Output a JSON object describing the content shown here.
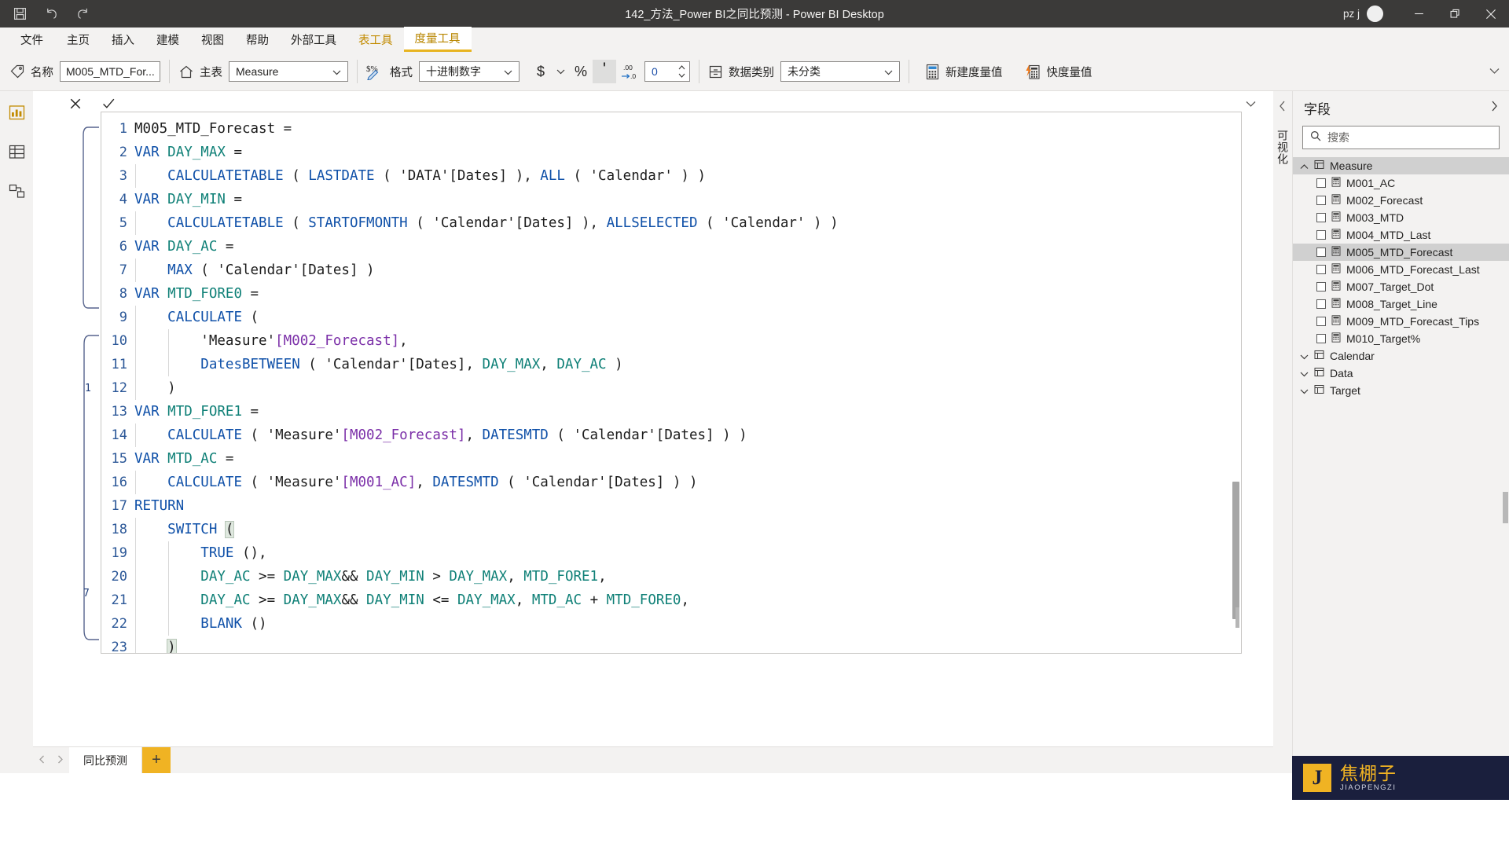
{
  "window": {
    "title": "142_方法_Power BI之同比预测 - Power BI Desktop",
    "user": "pz j",
    "quick_access": [
      {
        "name": "save-icon",
        "label": "保存"
      },
      {
        "name": "undo-icon",
        "label": "撤消"
      },
      {
        "name": "redo-icon",
        "label": "恢复"
      }
    ],
    "controls": [
      {
        "name": "minimize-button",
        "label": "最小化"
      },
      {
        "name": "restore-button",
        "label": "还原"
      },
      {
        "name": "close-button",
        "label": "关闭"
      }
    ]
  },
  "ribbon": {
    "tabs": [
      {
        "label": "文件",
        "type": "file",
        "active": false
      },
      {
        "label": "主页",
        "type": "normal",
        "active": false
      },
      {
        "label": "插入",
        "type": "normal",
        "active": false
      },
      {
        "label": "建模",
        "type": "normal",
        "active": false
      },
      {
        "label": "视图",
        "type": "normal",
        "active": false
      },
      {
        "label": "帮助",
        "type": "normal",
        "active": false
      },
      {
        "label": "外部工具",
        "type": "normal",
        "active": false
      },
      {
        "label": "表工具",
        "type": "context",
        "active": false
      },
      {
        "label": "度量工具",
        "type": "context",
        "active": true
      }
    ],
    "structure_group": {
      "name_label": "名称",
      "name_value": "M005_MTD_For...",
      "home_table_label": "主表",
      "home_table_value": "Measure"
    },
    "format_group": {
      "format_label": "格式",
      "format_value": "十进制数字",
      "currency_symbol": "$",
      "percent_symbol": "%",
      "comma_symbol": "'",
      "decimals_label": ".00→.0",
      "decimals_value": "0"
    },
    "properties_group": {
      "data_category_label": "数据类别",
      "data_category_value": "未分类"
    },
    "calculations_group": {
      "new_measure_label": "新建度量值",
      "quick_measure_label": "快度量值"
    }
  },
  "left_rail": [
    {
      "name": "report-view",
      "label": "报表视图"
    },
    {
      "name": "data-view",
      "label": "数据视图"
    },
    {
      "name": "model-view",
      "label": "模型视图"
    }
  ],
  "formula_bar": {
    "cancel_label": "取消",
    "commit_label": "提交",
    "expand_label": "展开编辑器"
  },
  "editor": {
    "lines": [
      {
        "n": "1",
        "tokens": [
          {
            "t": "M005_MTD_Forecast =",
            "c": "plain"
          }
        ]
      },
      {
        "n": "2",
        "tokens": [
          {
            "t": "VAR ",
            "c": "kw"
          },
          {
            "t": "DAY_MAX",
            "c": "varn"
          },
          {
            "t": " =",
            "c": "plain"
          }
        ]
      },
      {
        "n": "3",
        "tokens": [
          {
            "t": "    ",
            "c": "plain"
          },
          {
            "t": "CALCULATETABLE",
            "c": "fn"
          },
          {
            "t": " ( ",
            "c": "plain"
          },
          {
            "t": "LASTDATE",
            "c": "fn"
          },
          {
            "t": " ( 'DATA'[Dates] ), ",
            "c": "plain"
          },
          {
            "t": "ALL",
            "c": "fn"
          },
          {
            "t": " ( 'Calendar' ) )",
            "c": "plain"
          }
        ]
      },
      {
        "n": "4",
        "tokens": [
          {
            "t": "VAR ",
            "c": "kw"
          },
          {
            "t": "DAY_MIN",
            "c": "varn"
          },
          {
            "t": " =",
            "c": "plain"
          }
        ]
      },
      {
        "n": "5",
        "tokens": [
          {
            "t": "    ",
            "c": "plain"
          },
          {
            "t": "CALCULATETABLE",
            "c": "fn"
          },
          {
            "t": " ( ",
            "c": "plain"
          },
          {
            "t": "STARTOFMONTH",
            "c": "fn"
          },
          {
            "t": " ( 'Calendar'[Dates] ), ",
            "c": "plain"
          },
          {
            "t": "ALLSELECTED",
            "c": "fn"
          },
          {
            "t": " ( 'Calendar' ) )",
            "c": "plain"
          }
        ]
      },
      {
        "n": "6",
        "tokens": [
          {
            "t": "VAR ",
            "c": "kw"
          },
          {
            "t": "DAY_AC",
            "c": "varn"
          },
          {
            "t": " =",
            "c": "plain"
          }
        ]
      },
      {
        "n": "7",
        "tokens": [
          {
            "t": "    ",
            "c": "plain"
          },
          {
            "t": "MAX",
            "c": "fn"
          },
          {
            "t": " ( 'Calendar'[Dates] )",
            "c": "plain"
          }
        ]
      },
      {
        "n": "8",
        "tokens": [
          {
            "t": "VAR ",
            "c": "kw"
          },
          {
            "t": "MTD_FORE0",
            "c": "varn"
          },
          {
            "t": " =",
            "c": "plain"
          }
        ]
      },
      {
        "n": "9",
        "tokens": [
          {
            "t": "    ",
            "c": "plain"
          },
          {
            "t": "CALCULATE",
            "c": "fn"
          },
          {
            "t": " (",
            "c": "plain"
          }
        ]
      },
      {
        "n": "10",
        "tokens": [
          {
            "t": "        'Measure'",
            "c": "plain"
          },
          {
            "t": "[M002_Forecast]",
            "c": "msr"
          },
          {
            "t": ",",
            "c": "plain"
          }
        ]
      },
      {
        "n": "11",
        "tokens": [
          {
            "t": "        ",
            "c": "plain"
          },
          {
            "t": "DatesBETWEEN",
            "c": "fn"
          },
          {
            "t": " ( 'Calendar'[Dates], ",
            "c": "plain"
          },
          {
            "t": "DAY_MAX",
            "c": "varn"
          },
          {
            "t": ", ",
            "c": "plain"
          },
          {
            "t": "DAY_AC",
            "c": "varn"
          },
          {
            "t": " )",
            "c": "plain"
          }
        ]
      },
      {
        "n": "12",
        "tokens": [
          {
            "t": "    )",
            "c": "plain"
          }
        ]
      },
      {
        "n": "13",
        "tokens": [
          {
            "t": "VAR ",
            "c": "kw"
          },
          {
            "t": "MTD_FORE1",
            "c": "varn"
          },
          {
            "t": " =",
            "c": "plain"
          }
        ]
      },
      {
        "n": "14",
        "tokens": [
          {
            "t": "    ",
            "c": "plain"
          },
          {
            "t": "CALCULATE",
            "c": "fn"
          },
          {
            "t": " ( 'Measure'",
            "c": "plain"
          },
          {
            "t": "[M002_Forecast]",
            "c": "msr"
          },
          {
            "t": ", ",
            "c": "plain"
          },
          {
            "t": "DATESMTD",
            "c": "fn"
          },
          {
            "t": " ( 'Calendar'[Dates] ) )",
            "c": "plain"
          }
        ]
      },
      {
        "n": "15",
        "tokens": [
          {
            "t": "VAR ",
            "c": "kw"
          },
          {
            "t": "MTD_AC",
            "c": "varn"
          },
          {
            "t": " =",
            "c": "plain"
          }
        ]
      },
      {
        "n": "16",
        "tokens": [
          {
            "t": "    ",
            "c": "plain"
          },
          {
            "t": "CALCULATE",
            "c": "fn"
          },
          {
            "t": " ( 'Measure'",
            "c": "plain"
          },
          {
            "t": "[M001_AC]",
            "c": "msr"
          },
          {
            "t": ", ",
            "c": "plain"
          },
          {
            "t": "DATESMTD",
            "c": "fn"
          },
          {
            "t": " ( 'Calendar'[Dates] ) )",
            "c": "plain"
          }
        ]
      },
      {
        "n": "17",
        "tokens": [
          {
            "t": "RETURN",
            "c": "kw"
          }
        ]
      },
      {
        "n": "18",
        "tokens": [
          {
            "t": "    ",
            "c": "plain"
          },
          {
            "t": "SWITCH",
            "c": "fn"
          },
          {
            "t": " ",
            "c": "plain"
          },
          {
            "t": "(",
            "c": "hl"
          }
        ]
      },
      {
        "n": "19",
        "tokens": [
          {
            "t": "        ",
            "c": "plain"
          },
          {
            "t": "TRUE",
            "c": "fn"
          },
          {
            "t": " (),",
            "c": "plain"
          }
        ]
      },
      {
        "n": "20",
        "tokens": [
          {
            "t": "        ",
            "c": "plain"
          },
          {
            "t": "DAY_AC",
            "c": "varn"
          },
          {
            "t": " >= ",
            "c": "plain"
          },
          {
            "t": "DAY_MAX",
            "c": "varn"
          },
          {
            "t": "&& ",
            "c": "plain"
          },
          {
            "t": "DAY_MIN",
            "c": "varn"
          },
          {
            "t": " > ",
            "c": "plain"
          },
          {
            "t": "DAY_MAX",
            "c": "varn"
          },
          {
            "t": ", ",
            "c": "plain"
          },
          {
            "t": "MTD_FORE1",
            "c": "varn"
          },
          {
            "t": ",",
            "c": "plain"
          }
        ]
      },
      {
        "n": "21",
        "tokens": [
          {
            "t": "        ",
            "c": "plain"
          },
          {
            "t": "DAY_AC",
            "c": "varn"
          },
          {
            "t": " >= ",
            "c": "plain"
          },
          {
            "t": "DAY_MAX",
            "c": "varn"
          },
          {
            "t": "&& ",
            "c": "plain"
          },
          {
            "t": "DAY_MIN",
            "c": "varn"
          },
          {
            "t": " <= ",
            "c": "plain"
          },
          {
            "t": "DAY_MAX",
            "c": "varn"
          },
          {
            "t": ", ",
            "c": "plain"
          },
          {
            "t": "MTD_AC",
            "c": "varn"
          },
          {
            "t": " + ",
            "c": "plain"
          },
          {
            "t": "MTD_FORE0",
            "c": "varn"
          },
          {
            "t": ",",
            "c": "plain"
          }
        ]
      },
      {
        "n": "22",
        "tokens": [
          {
            "t": "        ",
            "c": "plain"
          },
          {
            "t": "BLANK",
            "c": "fn"
          },
          {
            "t": " ()",
            "c": "plain"
          }
        ]
      },
      {
        "n": "23",
        "tokens": [
          {
            "t": "    ",
            "c": "plain"
          },
          {
            "t": ")",
            "c": "hl"
          }
        ]
      }
    ]
  },
  "fields_panel": {
    "title": "字段",
    "collapse_label": "折叠",
    "expand_label": "展开",
    "search_placeholder": "搜索",
    "vertical_label": "可视化",
    "tables": [
      {
        "name": "Measure",
        "expanded": true,
        "selected": true,
        "fields": [
          {
            "label": "M001_AC",
            "selected": false
          },
          {
            "label": "M002_Forecast",
            "selected": false
          },
          {
            "label": "M003_MTD",
            "selected": false
          },
          {
            "label": "M004_MTD_Last",
            "selected": false
          },
          {
            "label": "M005_MTD_Forecast",
            "selected": true
          },
          {
            "label": "M006_MTD_Forecast_Last",
            "selected": false
          },
          {
            "label": "M007_Target_Dot",
            "selected": false
          },
          {
            "label": "M008_Target_Line",
            "selected": false
          },
          {
            "label": "M009_MTD_Forecast_Tips",
            "selected": false
          },
          {
            "label": "M010_Target%",
            "selected": false
          }
        ]
      },
      {
        "name": "Calendar",
        "expanded": false,
        "selected": false,
        "fields": []
      },
      {
        "name": "Data",
        "expanded": false,
        "selected": false,
        "fields": []
      },
      {
        "name": "Target",
        "expanded": false,
        "selected": false,
        "fields": []
      }
    ]
  },
  "page_tabs": {
    "prev_label": "上一页",
    "next_label": "下一页",
    "tabs": [
      {
        "label": "同比预测",
        "active": true
      }
    ],
    "add_label": "+"
  },
  "watermark": {
    "logo_letter": "J",
    "cn_text": "焦棚子",
    "py_text": "JIAOPENGZI"
  },
  "colors": {
    "titlebar_bg": "#3b3a39",
    "ribbon_bg": "#f3f2f1",
    "accent_gold": "#e8b421",
    "context_tab": "#c28b00",
    "fn_blue": "#0f50a8",
    "var_teal": "#0f8077",
    "measure_purple": "#7b2fa8",
    "linenum_blue": "#2b5797",
    "watermark_navy": "#1a1f3d"
  }
}
